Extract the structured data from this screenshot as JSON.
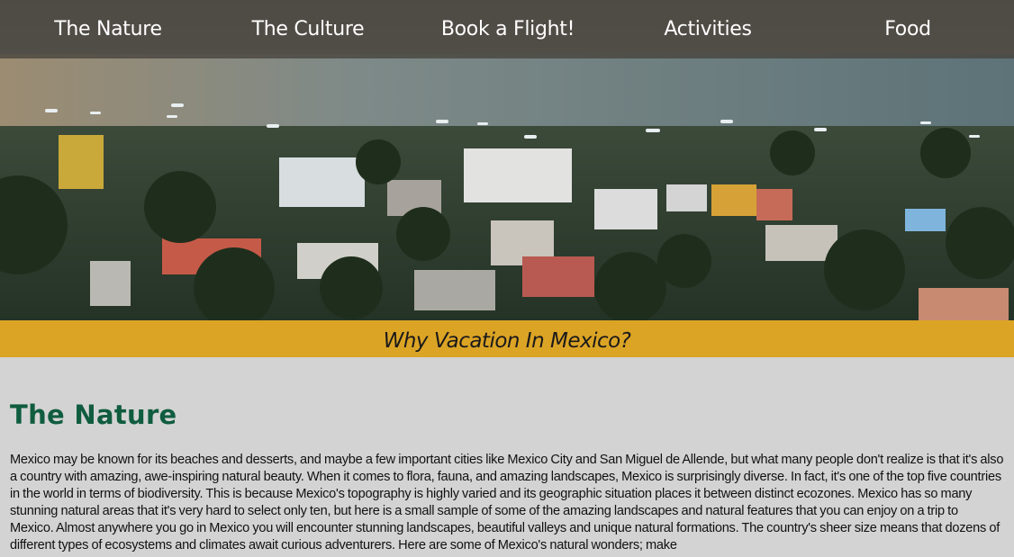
{
  "nav": {
    "items": [
      {
        "label": "The Nature"
      },
      {
        "label": "The Culture"
      },
      {
        "label": "Book a Flight!"
      },
      {
        "label": "Activities"
      },
      {
        "label": "Food"
      }
    ]
  },
  "hero": {
    "image_description_icon": "coastal-town-photo"
  },
  "tagline": "Why Vacation In Mexico?",
  "section": {
    "title": "The Nature",
    "body": "Mexico may be known for its beaches and desserts, and maybe a few important cities like Mexico City and San Miguel de Allende, but what many people don't realize is that it's also a country with amazing, awe-inspiring natural beauty. When it comes to flora, fauna, and amazing landscapes, Mexico is surprisingly diverse. In fact, it's one of the top five countries in the world in terms of biodiversity. This is because Mexico's topography is highly varied and its geographic situation places it between distinct ecozones. Mexico has so many stunning natural areas that it's very hard to select only ten, but here is a small sample of some of the amazing landscapes and natural features that you can enjoy on a trip to Mexico. Almost anywhere you go in Mexico you will encounter stunning landscapes, beautiful valleys and unique natural formations. The country's sheer size means that dozens of different types of ecosystems and climates await curious adventurers. Here are some of Mexico's natural wonders; make"
  },
  "colors": {
    "nav_bg": "#46423c",
    "tagline_bg": "#dca425",
    "title_green": "#0f5c3f",
    "page_bg": "#d3d3d3"
  }
}
